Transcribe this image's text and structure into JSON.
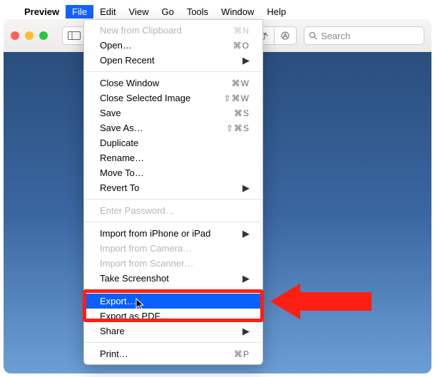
{
  "menubar": {
    "app": "Preview",
    "items": [
      "File",
      "Edit",
      "View",
      "Go",
      "Tools",
      "Window",
      "Help"
    ],
    "active_index": 0
  },
  "toolbar": {
    "search_placeholder": "Search"
  },
  "menu": {
    "groups": [
      [
        {
          "label": "New from Clipboard",
          "shortcut": "⌘N",
          "disabled": true
        },
        {
          "label": "Open…",
          "shortcut": "⌘O"
        },
        {
          "label": "Open Recent",
          "submenu": true
        }
      ],
      [
        {
          "label": "Close Window",
          "shortcut": "⌘W"
        },
        {
          "label": "Close Selected Image",
          "shortcut": "⇧⌘W"
        },
        {
          "label": "Save",
          "shortcut": "⌘S"
        },
        {
          "label": "Save As…",
          "shortcut": "⇧⌘S"
        },
        {
          "label": "Duplicate"
        },
        {
          "label": "Rename…"
        },
        {
          "label": "Move To…"
        },
        {
          "label": "Revert To",
          "submenu": true
        }
      ],
      [
        {
          "label": "Enter Password…",
          "disabled": true
        }
      ],
      [
        {
          "label": "Import from iPhone or iPad",
          "submenu": true
        },
        {
          "label": "Import from Camera…",
          "disabled": true
        },
        {
          "label": "Import from Scanner…",
          "disabled": true
        },
        {
          "label": "Take Screenshot",
          "submenu": true
        }
      ],
      [
        {
          "label": "Export…",
          "selected": true
        },
        {
          "label": "Export as PDF…"
        },
        {
          "label": "Share",
          "submenu": true
        }
      ],
      [
        {
          "label": "Print…",
          "shortcut": "⌘P"
        }
      ]
    ]
  },
  "annotation": {
    "highlighted_item": "Export…"
  }
}
